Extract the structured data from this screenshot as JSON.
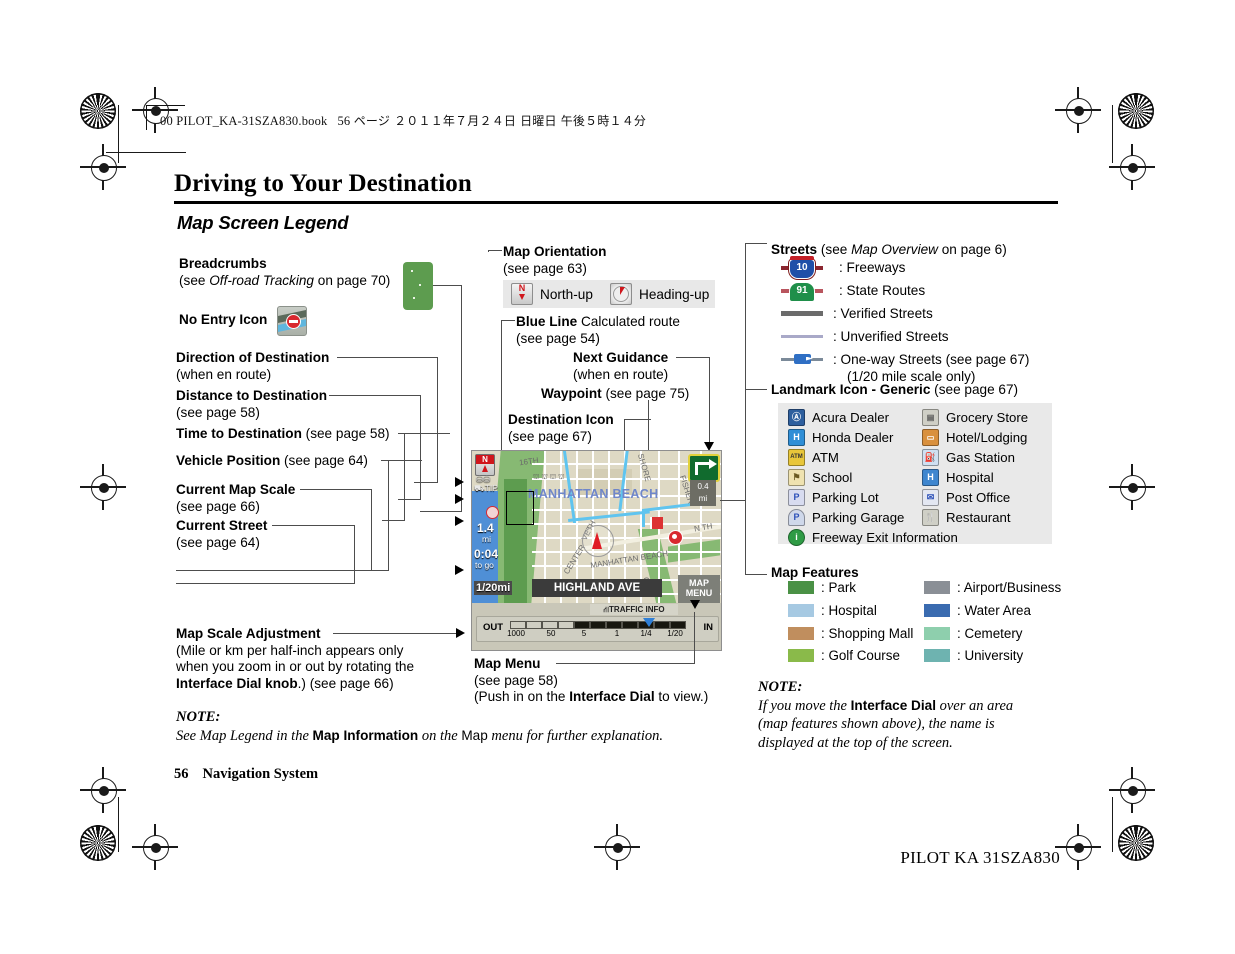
{
  "header": {
    "book_line": "00 PILOT_KA-31SZA830.book",
    "book_page": "56",
    "book_jp": "ページ  ２０１１年７月２４日  日曜日  午後５時１４分",
    "title": "Driving to Your Destination",
    "subtitle": "Map Screen Legend"
  },
  "left_labels": {
    "breadcrumbs": {
      "bold": "Breadcrumbs",
      "sub_pre": "(see ",
      "sub_it": "Off-road Tracking",
      "sub_post": " on page 70)"
    },
    "no_entry": "No Entry Icon",
    "direction": {
      "bold": "Direction of Destination",
      "sub": "(when en route)"
    },
    "distance": {
      "bold": "Distance to Destination",
      "sub": "(see page 58)"
    },
    "time": {
      "bold": "Time to Destination",
      "sub": " (see page 58)"
    },
    "vehicle": {
      "bold": "Vehicle Position",
      "sub": " (see page 64)"
    },
    "scale": {
      "bold": "Current Map Scale",
      "sub": "(see page 66)"
    },
    "street": {
      "bold": "Current Street",
      "sub": "(see page 64)"
    }
  },
  "mid_labels": {
    "orientation": {
      "bold": "Map Orientation",
      "sub": "(see page 63)"
    },
    "orientation_options": [
      {
        "label": "North-up",
        "icon": "north-up-icon"
      },
      {
        "label": "Heading-up",
        "icon": "heading-up-icon"
      }
    ],
    "blue_line": {
      "bold": "Blue Line",
      "rest": " Calculated route",
      "sub": "(see page 54)"
    },
    "next_guidance": {
      "bold": "Next Guidance",
      "sub": "(when en route)"
    },
    "waypoint": {
      "bold": "Waypoint",
      "sub": " (see page 75)"
    },
    "destination_icon": {
      "bold": "Destination Icon",
      "sub": "(see page 67)"
    }
  },
  "streets": {
    "heading_bold": "Streets",
    "heading_pre": " (see ",
    "heading_it": "Map Overview",
    "heading_post": " on page 6)",
    "rows": [
      {
        "label": ": Freeways",
        "type": "interstate-shield",
        "badge": "10"
      },
      {
        "label": ": State Routes",
        "type": "state-shield",
        "badge": "91"
      },
      {
        "label": ": Verified Streets",
        "type": "verified"
      },
      {
        "label": ": Unverified Streets",
        "type": "unverified"
      },
      {
        "label": ": One-way Streets (see page 67)",
        "type": "oneway",
        "sub": "(1/20 mile scale only)"
      }
    ]
  },
  "landmarks": {
    "heading_bold": "Landmark Icon - Generic",
    "heading_rest": " (see page 67)",
    "left": [
      {
        "label": "Acura Dealer",
        "icon": "acura-dealer-icon",
        "glyph": "A",
        "bg": "#2e5f9e"
      },
      {
        "label": "Honda Dealer",
        "icon": "honda-dealer-icon",
        "glyph": "H",
        "bg": "#2f8ed6"
      },
      {
        "label": "ATM",
        "icon": "atm-icon",
        "glyph": "ATM",
        "bg": "#e8c63a"
      },
      {
        "label": "School",
        "icon": "school-icon",
        "glyph": "",
        "bg": "#e8d79a"
      },
      {
        "label": "Parking Lot",
        "icon": "parking-lot-icon",
        "glyph": "P",
        "bg": "#4a6fd0"
      },
      {
        "label": "Parking Garage",
        "icon": "parking-garage-icon",
        "glyph": "P",
        "bg": "#5a86c9"
      },
      {
        "label": "Freeway Exit Information",
        "icon": "freeway-exit-info-icon",
        "glyph": "i",
        "bg": "#2f9b45"
      }
    ],
    "right": [
      {
        "label": "Grocery Store",
        "icon": "grocery-store-icon",
        "glyph": "",
        "bg": "#b9b9b2"
      },
      {
        "label": "Hotel/Lodging",
        "icon": "hotel-lodging-icon",
        "glyph": "",
        "bg": "#d9903d"
      },
      {
        "label": "Gas Station",
        "icon": "gas-station-icon",
        "glyph": "",
        "bg": "#4f8cc9"
      },
      {
        "label": "Hospital",
        "icon": "hospital-icon",
        "glyph": "H",
        "bg": "#3f86cf"
      },
      {
        "label": "Post Office",
        "icon": "post-office-icon",
        "glyph": "",
        "bg": "#3f6fc0"
      },
      {
        "label": "Restaurant",
        "icon": "restaurant-icon",
        "glyph": "",
        "bg": "#b7b7ae"
      }
    ]
  },
  "map_features": {
    "heading": "Map Features",
    "left": [
      {
        "label": ": Park",
        "color": "#4a9145"
      },
      {
        "label": ": Hospital",
        "color": "#a6c9e2"
      },
      {
        "label": ": Shopping Mall",
        "color": "#c08e5e"
      },
      {
        "label": ": Golf Course",
        "color": "#8aba4a"
      }
    ],
    "right": [
      {
        "label": ": Airport/Business",
        "color": "#8a8f96"
      },
      {
        "label": ": Water Area",
        "color": "#3a6bb0"
      },
      {
        "label": ": Cemetery",
        "color": "#8ecfad"
      },
      {
        "label": ": University",
        "color": "#6eb3b0"
      }
    ]
  },
  "nav_screen": {
    "distance_to_dest": "1.4",
    "distance_unit": "mi",
    "time_to_dest": "0:04",
    "time_sub": "to go",
    "current_scale": "1/20mi",
    "guidance_distance": "0.4",
    "guidance_unit": "mi",
    "current_street": "HIGHLAND AVE",
    "map_menu_1": "MAP",
    "map_menu_2": "MENU",
    "area_name": "MANHATTAN BEACH",
    "traffic_label": "TRAFFIC INFO",
    "scale_out": "OUT",
    "scale_in": "IN",
    "scale_ticks": [
      "1000",
      "50",
      "5",
      "1",
      "1/4",
      "1/20"
    ],
    "street_labels": [
      "16TH",
      "VETH",
      "CENTER",
      "MANHATTAN BEACH",
      "FISHER",
      "SHORE",
      "CRE",
      "N TH"
    ]
  },
  "bottom": {
    "map_scale_adjustment": {
      "bold": "Map Scale Adjustment",
      "l1": "(Mile or km per half-inch appears only",
      "l2": "when you zoom in or out by rotating the",
      "l3_bold": "Interface Dial knob",
      "l3_rest": ".) (see page 66)"
    },
    "map_menu": {
      "bold": "Map Menu",
      "l1": "(see page 58)",
      "l2_pre": "(Push in on the ",
      "l2_bold": "Interface Dial",
      "l2_post": " to view.)"
    },
    "note_left": {
      "head": "NOTE:",
      "p1": "See Map Legend in the ",
      "b1": "Map Information",
      "p2": " on the ",
      "n1": "Map",
      "p3": " menu for further explanation."
    },
    "note_right": {
      "head": "NOTE:",
      "p1": "If you move the ",
      "b1": "Interface Dial",
      "p2": " over an area",
      "l2": "(map features shown above), the name is",
      "l3": "displayed at the top of the screen."
    }
  },
  "footer": {
    "page": "56",
    "section": "Navigation System",
    "part_number": "PILOT KA  31SZA830"
  }
}
